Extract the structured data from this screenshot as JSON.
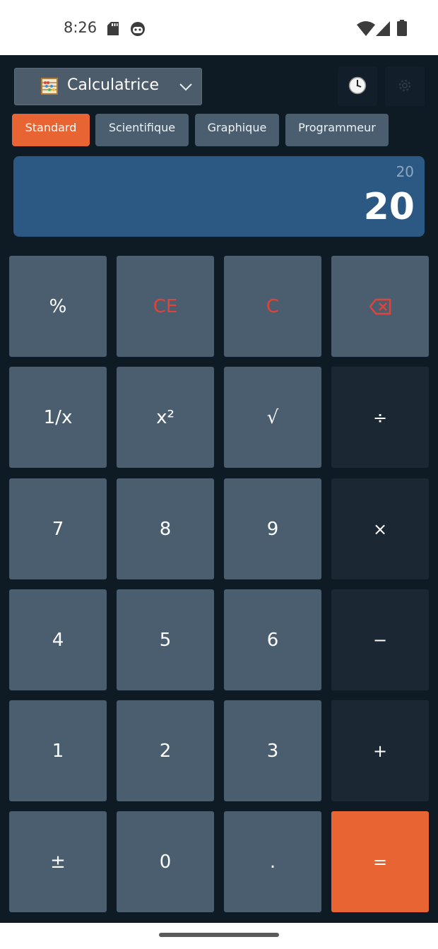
{
  "status_bar": {
    "time": "8:26"
  },
  "header": {
    "app_name": "Calculatrice"
  },
  "tabs": [
    {
      "label": "Standard",
      "active": true
    },
    {
      "label": "Scientifique",
      "active": false
    },
    {
      "label": "Graphique",
      "active": false
    },
    {
      "label": "Programmeur",
      "active": false
    }
  ],
  "display": {
    "expression": "20",
    "result": "20"
  },
  "keypad": {
    "percent": "%",
    "clear_entry": "CE",
    "clear": "C",
    "reciprocal": "1/x",
    "square": "x²",
    "sqrt": "√",
    "divide": "÷",
    "seven": "7",
    "eight": "8",
    "nine": "9",
    "multiply": "×",
    "four": "4",
    "five": "5",
    "six": "6",
    "minus": "−",
    "one": "1",
    "two": "2",
    "three": "3",
    "plus": "+",
    "negate": "±",
    "zero": "0",
    "decimal": ".",
    "equals": "="
  },
  "colors": {
    "accent": "#e96433",
    "background": "#0e1a24",
    "key": "#4a5e70",
    "operator_key": "#1b2733",
    "display": "#2c5984",
    "danger": "#e0433a"
  },
  "icons": [
    "sd-card-icon",
    "android-icon",
    "wifi-icon",
    "signal-icon",
    "battery-icon",
    "abacus-icon",
    "chevron-down-icon",
    "clock-icon",
    "gear-icon",
    "backspace-icon"
  ]
}
